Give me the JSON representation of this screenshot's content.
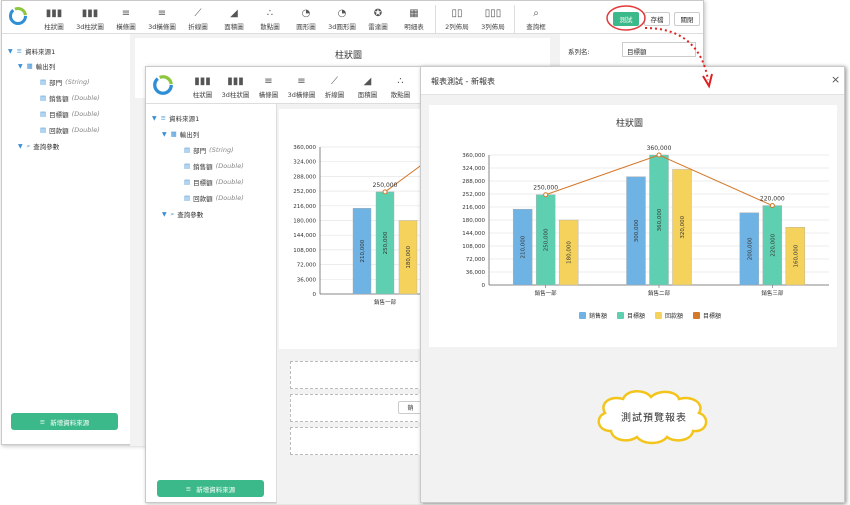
{
  "toolbar": {
    "items": [
      "柱狀圖",
      "3d柱狀圖",
      "橫條圖",
      "3d橫條圖",
      "折線圖",
      "面積圖",
      "散點圖",
      "圓形圖",
      "3d圓形圖",
      "雷達圖",
      "明細表",
      "2列佈局",
      "3列佈局",
      "查詢框"
    ],
    "test_label": "測試",
    "save_label": "存檔",
    "close_label": "關閉"
  },
  "back_toolbar": {
    "items": [
      "柱狀圖",
      "3d柱狀圖",
      "橫條圖",
      "3d橫條圖",
      "折線圖",
      "面積圖",
      "散點圖"
    ]
  },
  "tree": {
    "source": "資料來源1",
    "output": "輸出列",
    "fields": [
      {
        "name": "部門",
        "type": "(String)"
      },
      {
        "name": "銷售額",
        "type": "(Double)"
      },
      {
        "name": "目標額",
        "type": "(Double)"
      },
      {
        "name": "回款額",
        "type": "(Double)"
      }
    ],
    "query": "查詢參數",
    "add_source": "新增資料來源"
  },
  "props": {
    "series_label": "系列名:",
    "series_value": "目標額"
  },
  "back_chart": {
    "title": "柱狀圖",
    "yticks": [
      "360,000",
      "324,000",
      "288,000",
      "252,000",
      "216,000",
      "180,000",
      "144,000",
      "108,000",
      "72,000",
      "36,000",
      "0"
    ],
    "category": "銷售一部",
    "top_label": "250,000",
    "values": [
      "210,000",
      "250,000",
      "180,000"
    ],
    "tag": "銷"
  },
  "dialog": {
    "title": "報表測試 - 新報表",
    "close": "×",
    "callout": "測試預覽報表"
  },
  "chart_data": {
    "type": "bar",
    "title": "柱狀圖",
    "categories": [
      "銷售一部",
      "銷售二部",
      "銷售三部"
    ],
    "ylim": [
      0,
      360000
    ],
    "yticks": [
      "360,000",
      "324,000",
      "288,000",
      "252,000",
      "216,000",
      "180,000",
      "144,000",
      "108,000",
      "72,000",
      "36,000",
      "0"
    ],
    "series": [
      {
        "name": "銷售額",
        "values": [
          210000,
          300000,
          200000
        ],
        "labels": [
          "210,000",
          "300,000",
          "200,000"
        ],
        "color": "#6fb2e4"
      },
      {
        "name": "目標額",
        "values": [
          250000,
          360000,
          220000
        ],
        "labels": [
          "250,000",
          "360,000",
          "220,000"
        ],
        "color": "#5ecfb1"
      },
      {
        "name": "回款額",
        "values": [
          180000,
          320000,
          160000
        ],
        "labels": [
          "180,000",
          "320,000",
          "160,000"
        ],
        "color": "#f5d25c"
      }
    ],
    "line": {
      "name": "目標額",
      "values": [
        250000,
        360000,
        220000
      ],
      "labels": [
        "250,000",
        "360,000",
        "220,000"
      ],
      "color": "#d4782a"
    },
    "legend": "bottom"
  }
}
